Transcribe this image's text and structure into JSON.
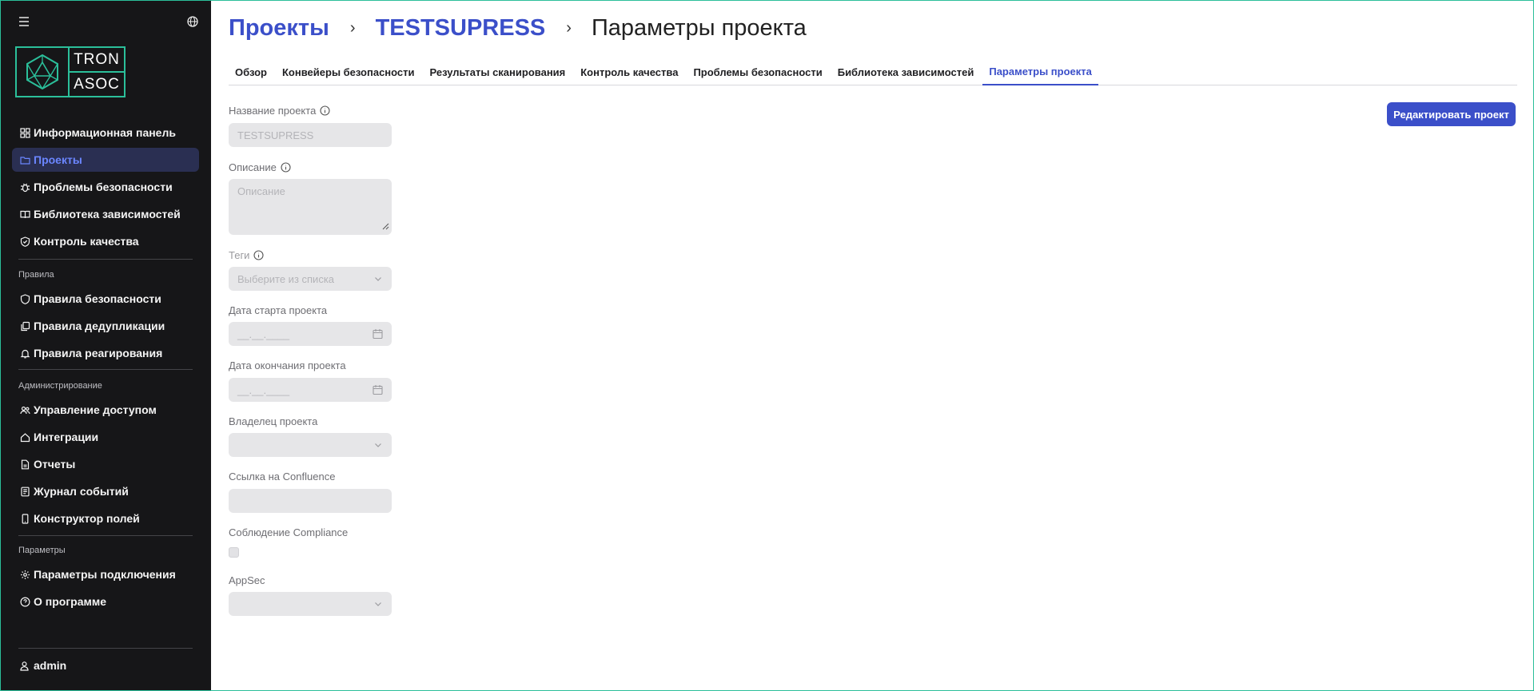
{
  "sidebar": {
    "logo": {
      "line1": "TRON",
      "line2": "ASOC"
    },
    "main_items": [
      {
        "label": "Информационная панель",
        "icon": "dashboard-icon",
        "active": false
      },
      {
        "label": "Проекты",
        "icon": "folder-icon",
        "active": true
      },
      {
        "label": "Проблемы безопасности",
        "icon": "bug-icon",
        "active": false
      },
      {
        "label": "Библиотека зависимостей",
        "icon": "book-icon",
        "active": false
      },
      {
        "label": "Контроль качества",
        "icon": "shield-check-icon",
        "active": false
      }
    ],
    "rules": {
      "label": "Правила",
      "items": [
        {
          "label": "Правила безопасности",
          "icon": "shield-icon"
        },
        {
          "label": "Правила дедупликации",
          "icon": "copy-icon"
        },
        {
          "label": "Правила реагирования",
          "icon": "bell-icon"
        }
      ]
    },
    "admin": {
      "label": "Администрирование",
      "items": [
        {
          "label": "Управление доступом",
          "icon": "users-icon"
        },
        {
          "label": "Интеграции",
          "icon": "home-icon"
        },
        {
          "label": "Отчеты",
          "icon": "file-icon"
        },
        {
          "label": "Журнал событий",
          "icon": "journal-icon"
        },
        {
          "label": "Конструктор полей",
          "icon": "phone-icon"
        }
      ]
    },
    "params": {
      "label": "Параметры",
      "items": [
        {
          "label": "Параметры подключения",
          "icon": "gear-icon"
        },
        {
          "label": "О программе",
          "icon": "help-icon"
        }
      ]
    },
    "user": "admin"
  },
  "breadcrumb": {
    "projects": "Проекты",
    "project": "TESTSUPRESS",
    "current": "Параметры проекта",
    "separator": "›"
  },
  "tabs": [
    {
      "label": "Обзор",
      "active": false
    },
    {
      "label": "Конвейеры безопасности",
      "active": false
    },
    {
      "label": "Результаты сканирования",
      "active": false
    },
    {
      "label": "Контроль качества",
      "active": false
    },
    {
      "label": "Проблемы безопасности",
      "active": false
    },
    {
      "label": "Библиотека зависимостей",
      "active": false
    },
    {
      "label": "Параметры проекта",
      "active": true
    }
  ],
  "edit_button": "Редактировать проект",
  "form": {
    "name": {
      "label": "Название проекта",
      "value": "TESTSUPRESS"
    },
    "description": {
      "label": "Описание",
      "placeholder": "Описание"
    },
    "tags": {
      "label": "Теги",
      "placeholder": "Выберите из списка"
    },
    "start_date": {
      "label": "Дата старта проекта",
      "placeholder": "__.__.____"
    },
    "end_date": {
      "label": "Дата окончания проекта",
      "placeholder": "__.__.____"
    },
    "owner": {
      "label": "Владелец проекта",
      "value": ""
    },
    "confluence": {
      "label": "Ссылка на Confluence",
      "value": ""
    },
    "compliance": {
      "label": "Соблюдение Compliance",
      "checked": false
    },
    "appsec": {
      "label": "AppSec",
      "value": ""
    }
  },
  "colors": {
    "accent": "#3b4fc9",
    "sidebar_bg": "#161618",
    "active_nav_bg": "#2a2f52",
    "logo_green": "#2bbf9a",
    "input_bg": "#e6e6e8"
  }
}
